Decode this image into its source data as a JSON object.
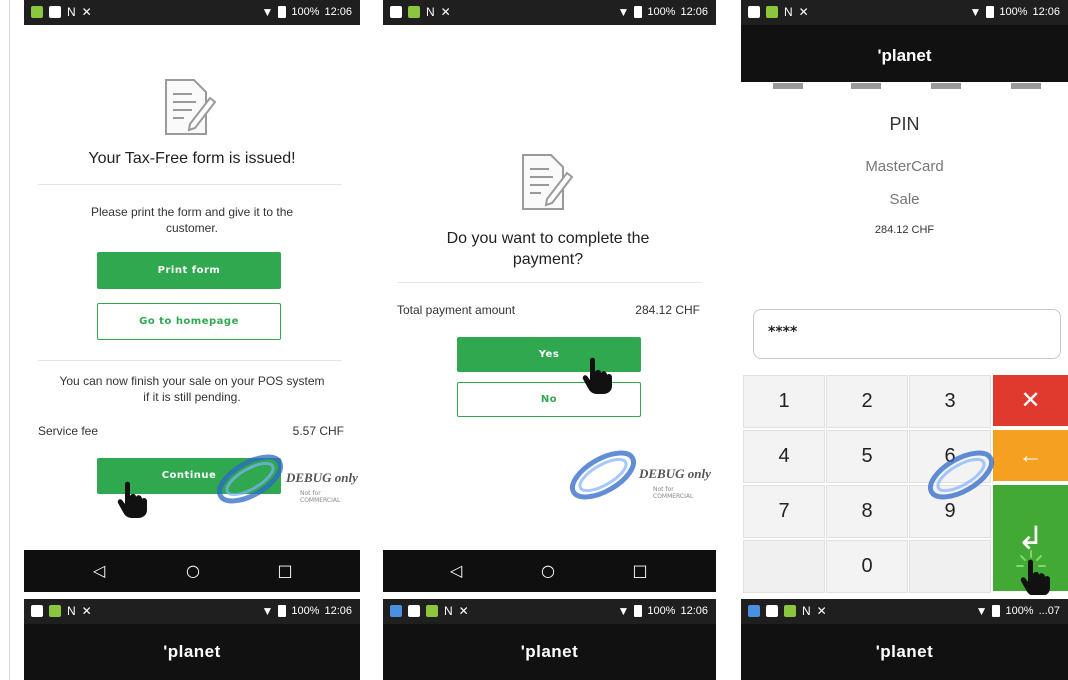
{
  "status_bar": {
    "battery": "100%",
    "time": "12:06",
    "time_obscured": "...07"
  },
  "brand": {
    "logo": "'planet"
  },
  "watermark": {
    "main": "DEBUG only",
    "sub": "Not for COMMERCIAL"
  },
  "screen1": {
    "title": "Your Tax-Free form is issued!",
    "instruction": "Please print the form and give it to the customer.",
    "print_button": "Print form",
    "home_button": "Go to homepage",
    "pos_note": "You can now finish your sale on your POS system if it is still pending.",
    "fee_label": "Service fee",
    "fee_value": "5.57 CHF",
    "continue_button": "Continue"
  },
  "screen2": {
    "title": "Do you want to complete the payment?",
    "total_label": "Total payment amount",
    "total_value": "284.12 CHF",
    "yes_button": "Yes",
    "no_button": "No"
  },
  "screen3": {
    "title": "PIN",
    "card": "MasterCard",
    "transaction": "Sale",
    "amount": "284.12 CHF",
    "pin_value": "****",
    "keys": [
      "1",
      "2",
      "3",
      "4",
      "5",
      "6",
      "7",
      "8",
      "9",
      "0"
    ],
    "cancel_key": "✕",
    "clear_key": "←",
    "enter_key": "↲"
  },
  "nav": {
    "back": "◁",
    "home": "○",
    "recent": "□"
  },
  "colors": {
    "green": "#2fa84f",
    "red": "#e03a2f",
    "orange": "#f5a020",
    "dark": "#111111"
  }
}
